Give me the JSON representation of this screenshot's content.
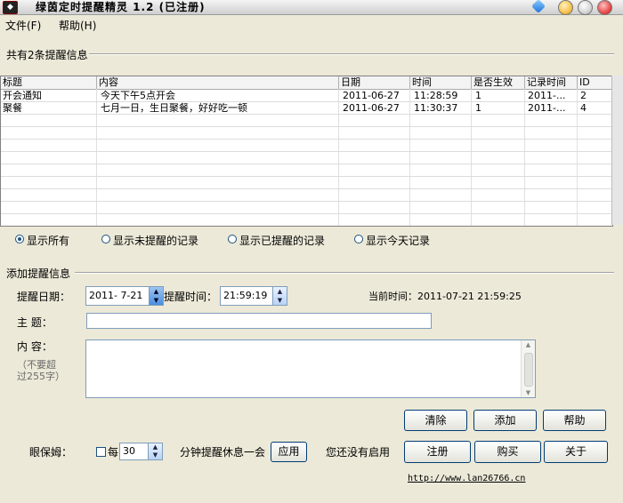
{
  "window": {
    "title": "绿茵定时提醒精灵 1.2 (已注册)"
  },
  "menu": [
    {
      "label": "文件(F)"
    },
    {
      "label": "帮助(H)"
    }
  ],
  "list_section": {
    "title": "共有2条提醒信息",
    "columns": [
      "标题",
      "内容",
      "日期",
      "时间",
      "是否生效",
      "记录时间",
      "ID"
    ],
    "rows": [
      [
        "开会通知",
        "今天下午5点开会",
        "2011-06-27",
        "11:28:59",
        "1",
        "2011-...",
        "2"
      ],
      [
        "聚餐",
        "七月一日，生日聚餐，好好吃一顿",
        "2011-06-27",
        "11:30:37",
        "1",
        "2011-...",
        "4"
      ]
    ]
  },
  "filters": {
    "options": [
      "显示所有",
      "显示未提醒的记录",
      "显示已提醒的记录",
      "显示今天记录"
    ],
    "selected": "显示所有"
  },
  "add_section": {
    "title": "添加提醒信息",
    "date_label": "提醒日期：",
    "date_value": "2011- 7-21",
    "time_label": "提醒时间：",
    "time_value": "21:59:19",
    "current_time_label": "当前时间：2011-07-21 21:59:25",
    "subject_label": "主    题：",
    "subject_value": "",
    "content_label": "内    容：",
    "content_hint_1": "（不要超",
    "content_hint_2": "过255字）",
    "content_value": ""
  },
  "buttons": {
    "clear": "清除",
    "add": "添加",
    "help": "帮助",
    "apply": "应用",
    "register": "注册",
    "buy": "购买",
    "about": "关于"
  },
  "eye_care": {
    "label": "眼保姆：",
    "every": "每",
    "interval": "30",
    "suffix": "分钟提醒休息一会",
    "checked": false,
    "status": "您还没有启用"
  },
  "footer": {
    "link": "http://www.lan26766.cn"
  },
  "icons": [
    "app-icon",
    "gem-icon",
    "minimize-icon",
    "maximize-icon",
    "close-icon",
    "spin-up-icon",
    "spin-down-icon"
  ]
}
